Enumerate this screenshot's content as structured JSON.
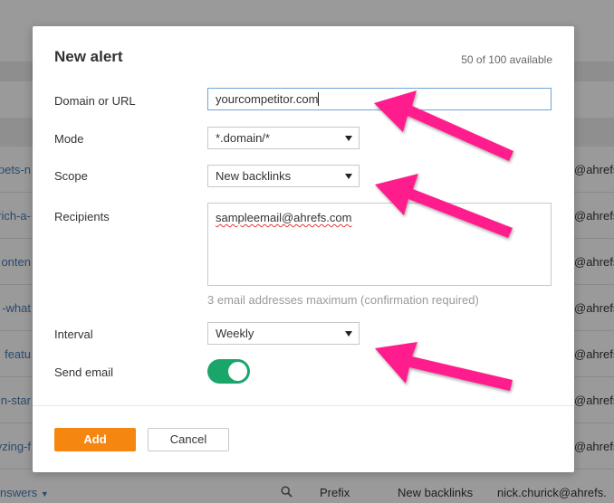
{
  "background": {
    "left_fragments": [
      "pets-n",
      "-rich-a",
      "onten",
      "what-",
      "featu",
      "n-star",
      "yzing-f"
    ],
    "right_fragments": [
      "@ahrefs.",
      "@ahrefs.",
      "@ahrefs.",
      "@ahrefs.",
      "@ahrefs.",
      "@ahrefs.",
      "@ahrefs."
    ],
    "footer": {
      "answers": "nswers",
      "scope": "Prefix",
      "type": "New backlinks",
      "email": "nick.churick@ahrefs."
    }
  },
  "modal": {
    "title": "New alert",
    "availability": "50 of 100 available",
    "fields": {
      "domain_label": "Domain or URL",
      "domain_value": "yourcompetitor.com",
      "mode_label": "Mode",
      "mode_value": "*.domain/*",
      "scope_label": "Scope",
      "scope_value": "New backlinks",
      "recipients_label": "Recipients",
      "recipients_value": "sampleemail@ahrefs.com",
      "recipients_hint": "3 email addresses maximum (confirmation required)",
      "interval_label": "Interval",
      "interval_value": "Weekly",
      "send_email_label": "Send email",
      "send_email_on": true
    },
    "buttons": {
      "add": "Add",
      "cancel": "Cancel"
    }
  },
  "colors": {
    "accent_orange": "#f5860f",
    "toggle_green": "#1aa56b",
    "annotation_magenta": "#ff1a8c",
    "focus_blue": "#6fa3d6"
  }
}
